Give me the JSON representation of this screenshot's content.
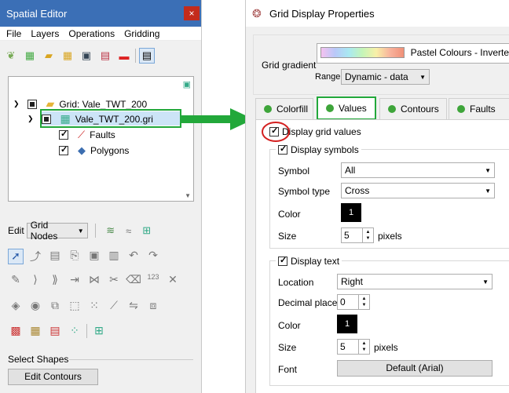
{
  "spatial_editor": {
    "title": "Spatial Editor",
    "close": "×",
    "menu": [
      "File",
      "Layers",
      "Operations",
      "Gridding"
    ],
    "tree": {
      "root": "Grid: Vale_TWT_200",
      "grid_file": "Vale_TWT_200.gri",
      "faults": "Faults",
      "polygons": "Polygons"
    },
    "edit_label": "Edit",
    "edit_mode": "Grid Nodes",
    "select_shapes_label": "Select Shapes",
    "edit_contours_button": "Edit Contours"
  },
  "grid_display": {
    "title": "Grid Display Properties",
    "gradient_label": "Grid gradient",
    "gradient_name": "Pastel Colours - Inverte",
    "range_label": "Range",
    "range_value": "Dynamic - data",
    "tabs": [
      "Colorfill",
      "Values",
      "Contours",
      "Faults"
    ],
    "active_tab": "Values",
    "display_grid_values": "Display grid values",
    "symbols": {
      "title": "Display symbols",
      "symbol_label": "Symbol",
      "symbol_value": "All",
      "type_label": "Symbol type",
      "type_value": "Cross",
      "color_label": "Color",
      "color_value": "1",
      "size_label": "Size",
      "size_value": "5",
      "size_unit": "pixels"
    },
    "text": {
      "title": "Display text",
      "location_label": "Location",
      "location_value": "Right",
      "decimals_label": "Decimal places",
      "decimals_value": "0",
      "color_label": "Color",
      "color_value": "1",
      "size_label": "Size",
      "size_value": "5",
      "size_unit": "pixels",
      "font_label": "Font",
      "font_value": "Default (Arial)"
    }
  },
  "colors": {
    "highlight_green": "#22a83a",
    "annotation_red": "#d42020",
    "tab_dot": "#3ea53a",
    "title_blue": "#3b6fb6"
  }
}
